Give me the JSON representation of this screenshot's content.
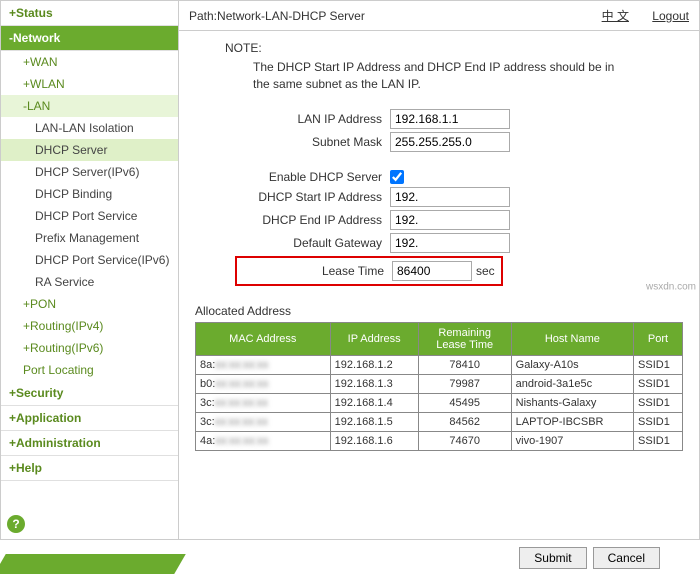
{
  "sidebar": {
    "items": [
      {
        "label": "+Status",
        "type": "top"
      },
      {
        "label": "-Network",
        "type": "top",
        "active": true
      },
      {
        "label": "+WAN",
        "type": "sub"
      },
      {
        "label": "+WLAN",
        "type": "sub"
      },
      {
        "label": "-LAN",
        "type": "sub",
        "active": true
      },
      {
        "label": "LAN-LAN Isolation",
        "type": "sub2"
      },
      {
        "label": "DHCP Server",
        "type": "sub2",
        "active": true
      },
      {
        "label": "DHCP Server(IPv6)",
        "type": "sub2"
      },
      {
        "label": "DHCP Binding",
        "type": "sub2"
      },
      {
        "label": "DHCP Port Service",
        "type": "sub2"
      },
      {
        "label": "Prefix Management",
        "type": "sub2"
      },
      {
        "label": "DHCP Port Service(IPv6)",
        "type": "sub2"
      },
      {
        "label": "RA Service",
        "type": "sub2"
      },
      {
        "label": "+PON",
        "type": "sub"
      },
      {
        "label": "+Routing(IPv4)",
        "type": "sub"
      },
      {
        "label": "+Routing(IPv6)",
        "type": "sub"
      },
      {
        "label": "Port Locating",
        "type": "sub"
      },
      {
        "label": "+Security",
        "type": "top"
      },
      {
        "label": "+Application",
        "type": "top"
      },
      {
        "label": "+Administration",
        "type": "top"
      },
      {
        "label": "+Help",
        "type": "top"
      }
    ],
    "help_icon": "?"
  },
  "path": {
    "prefix": "Path:",
    "value": "Network-LAN-DHCP Server",
    "lang_link": "中 文",
    "logout": "Logout"
  },
  "note": {
    "label": "NOTE:",
    "text": "The DHCP Start IP Address and DHCP End IP address should be in the same subnet as the LAN IP."
  },
  "form": {
    "lan_ip_label": "LAN IP Address",
    "lan_ip": "192.168.1.1",
    "subnet_label": "Subnet Mask",
    "subnet": "255.255.255.0",
    "enable_label": "Enable DHCP Server",
    "enable": true,
    "start_label": "DHCP Start IP Address",
    "start": "192.",
    "end_label": "DHCP End IP Address",
    "end": "192.",
    "gateway_label": "Default Gateway",
    "gateway": "192.",
    "lease_label": "Lease Time",
    "lease": "86400",
    "lease_unit": "sec"
  },
  "alloc": {
    "title": "Allocated Address",
    "headers": [
      "MAC Address",
      "IP Address",
      "Remaining Lease Time",
      "Host Name",
      "Port"
    ],
    "rows": [
      {
        "mac": "8a:",
        "ip": "192.168.1.2",
        "time": "78410",
        "host": "Galaxy-A10s",
        "port": "SSID1"
      },
      {
        "mac": "b0:",
        "ip": "192.168.1.3",
        "time": "79987",
        "host": "android-3a1e5c",
        "port": "SSID1"
      },
      {
        "mac": "3c:",
        "ip": "192.168.1.4",
        "time": "45495",
        "host": "Nishants-Galaxy",
        "port": "SSID1"
      },
      {
        "mac": "3c:",
        "ip": "192.168.1.5",
        "time": "84562",
        "host": "LAPTOP-IBCSBR",
        "port": "SSID1"
      },
      {
        "mac": "4a:",
        "ip": "192.168.1.6",
        "time": "74670",
        "host": "vivo-1907",
        "port": "SSID1"
      }
    ]
  },
  "footer": {
    "submit": "Submit",
    "cancel": "Cancel"
  },
  "watermark": "wsxdn.com"
}
